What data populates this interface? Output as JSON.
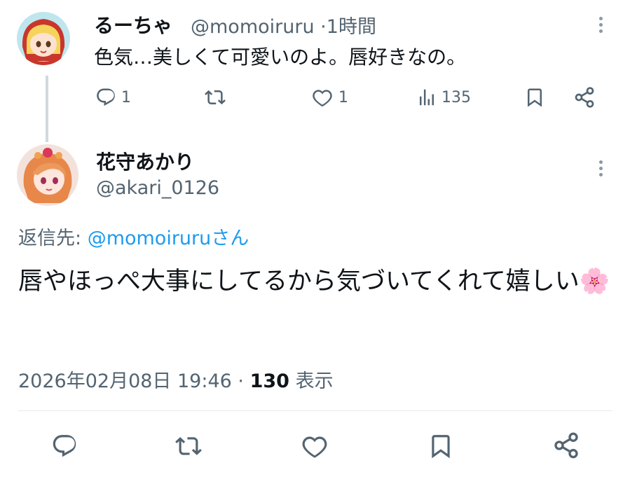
{
  "parent_tweet": {
    "display_name": "るーちゃ",
    "handle": "@momoiruru",
    "separator": "·",
    "time": "1時間",
    "text": "色気…美しくて可愛いのよ。唇好きなの。",
    "reply_count": "1",
    "like_count": "1",
    "view_count": "135",
    "icons": [
      "reply-icon",
      "retweet-icon",
      "like-icon",
      "views-icon",
      "bookmark-icon",
      "share-icon",
      "more-icon"
    ]
  },
  "main_tweet": {
    "display_name": "花守あかり",
    "handle": "@akari_0126",
    "reply_to_label": "返信先: ",
    "reply_to_handle": "@momoiruru",
    "reply_to_suffix": "さん",
    "text": "唇やほっぺ大事にしてるから気づいてくれて嬉しい🌸",
    "date": "2026年02月08日 19:46",
    "separator": "·",
    "views_count": "130",
    "views_label": "表示"
  },
  "bottom_actions": [
    "reply-icon",
    "retweet-icon",
    "like-icon",
    "bookmark-icon",
    "share-icon"
  ],
  "colors": {
    "text": "#0f1419",
    "secondary": "#536471",
    "link": "#1d9bf0",
    "thread_line": "#cfd9de",
    "divider": "#e6ecf0"
  }
}
